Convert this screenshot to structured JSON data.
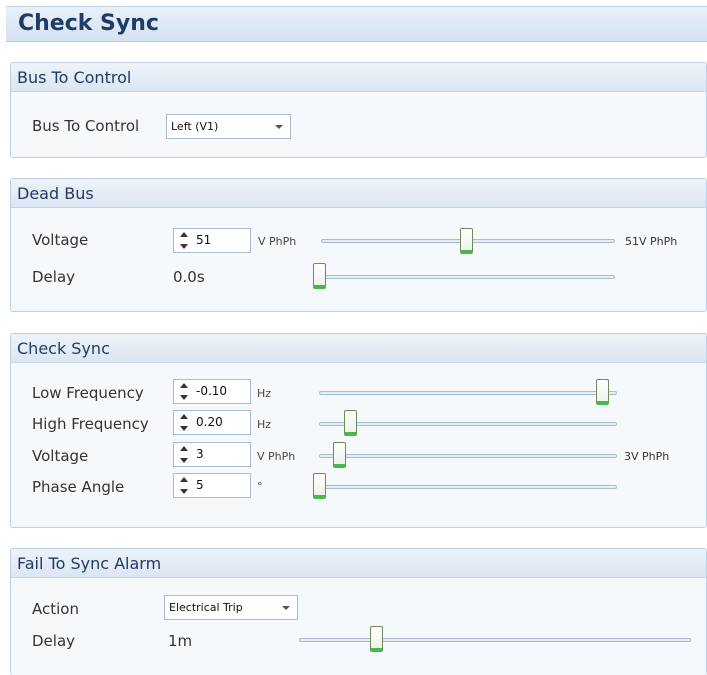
{
  "title": "Check Sync",
  "sections": {
    "bus_to_control": {
      "header": "Bus To Control",
      "label": "Bus To Control",
      "value": "Left (V1)"
    },
    "dead_bus": {
      "header": "Dead Bus",
      "voltage": {
        "label": "Voltage",
        "value": "51",
        "unit": "V PhPh",
        "readout": "51V PhPh",
        "slider_fraction": 0.49
      },
      "delay": {
        "label": "Delay",
        "value": "0.0s",
        "slider_fraction": 0.0
      }
    },
    "check_sync": {
      "header": "Check Sync",
      "low_frequency": {
        "label": "Low Frequency",
        "value": "-0.10",
        "unit": "Hz",
        "slider_fraction": 0.96
      },
      "high_frequency": {
        "label": "High Frequency",
        "value": "0.20",
        "unit": "Hz",
        "slider_fraction": 0.1
      },
      "voltage": {
        "label": "Voltage",
        "value": "3",
        "unit": "V PhPh",
        "readout": "3V PhPh",
        "slider_fraction": 0.06
      },
      "phase_angle": {
        "label": "Phase Angle",
        "value": "5",
        "unit": "°",
        "slider_fraction": 0.0
      }
    },
    "fail_to_sync_alarm": {
      "header": "Fail To Sync Alarm",
      "action": {
        "label": "Action",
        "value": "Electrical Trip"
      },
      "delay": {
        "label": "Delay",
        "value": "1m",
        "slider_fraction": 0.19
      }
    }
  }
}
